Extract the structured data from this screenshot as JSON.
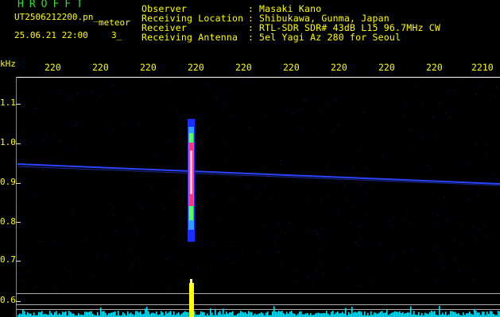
{
  "header": {
    "station": "HROFFT",
    "filename": "UT2506212200.pn_",
    "kind": "meteor",
    "datetime": "25.06.21 22:00",
    "minutes": "3_",
    "fields": [
      {
        "label": "Observer",
        "value": "Masaki Kano"
      },
      {
        "label": "Receiving Location",
        "value": "Shibukawa, Gunma, Japan"
      },
      {
        "label": "Receiver",
        "value": "RTL-SDR SDR# 43dB L15 96.7MHz CW"
      },
      {
        "label": "Receiving Antenna",
        "value": "5el Yagi Az 280 for Seoul"
      }
    ],
    "colon": ":"
  },
  "axes": {
    "y_unit": "kHz",
    "x_ticks": [
      "220",
      "220",
      "220",
      "220",
      "220",
      "220",
      "220",
      "220",
      "220",
      "2210"
    ],
    "y_ticks": [
      "1.1",
      "1.0",
      "0.9",
      "0.8",
      "0.7",
      "0.6"
    ]
  },
  "colors": {
    "text": "#ffff00",
    "station": "#22dd22",
    "background": "#000000",
    "carrier": "#2244ff",
    "meteor_echo": "#ff3377",
    "spectrum_peak": "#ffff00",
    "spectrum_noise": "#00e5ff"
  }
}
